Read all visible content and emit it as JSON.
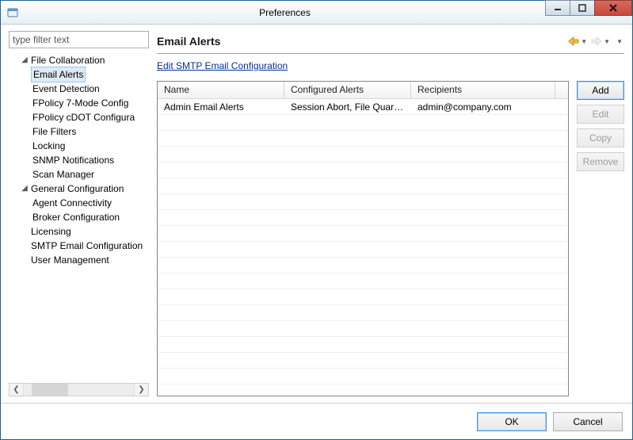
{
  "window": {
    "title": "Preferences"
  },
  "sidebar": {
    "filter_placeholder": "type filter text",
    "nodes": {
      "file_collaboration": "File Collaboration",
      "email_alerts": "Email Alerts",
      "event_detection": "Event Detection",
      "fpolicy7": "FPolicy 7-Mode Config",
      "fpolicycdot": "FPolicy cDOT Configura",
      "file_filters": "File Filters",
      "locking": "Locking",
      "snmp": "SNMP Notifications",
      "scan_manager": "Scan Manager",
      "general_configuration": "General Configuration",
      "agent_conn": "Agent Connectivity",
      "broker_conf": "Broker Configuration",
      "licensing": "Licensing",
      "smtp": "SMTP Email Configuration",
      "user_mgmt": "User Management"
    }
  },
  "main": {
    "title": "Email Alerts",
    "link_edit_smtp": "Edit SMTP Email Configuration",
    "columns": {
      "name": "Name",
      "configured_alerts": "Configured Alerts",
      "recipients": "Recipients"
    },
    "rows": [
      {
        "name": "Admin Email Alerts",
        "alerts": "Session Abort, File Quaran...",
        "recipients": "admin@company.com"
      }
    ],
    "buttons": {
      "add": "Add",
      "edit": "Edit",
      "copy": "Copy",
      "remove": "Remove"
    }
  },
  "footer": {
    "ok": "OK",
    "cancel": "Cancel"
  }
}
